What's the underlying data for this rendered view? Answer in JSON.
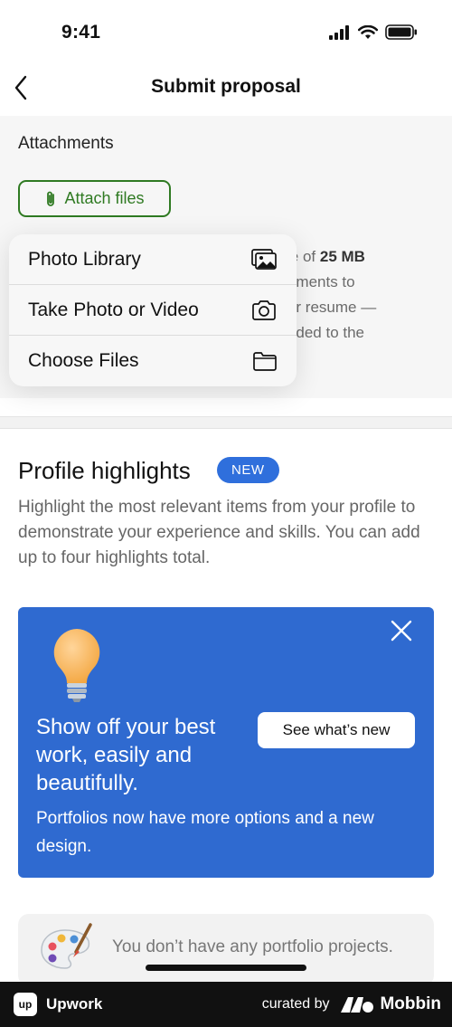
{
  "status_bar": {
    "time": "9:41",
    "icons": [
      "signal-icon",
      "wifi-icon",
      "battery-icon"
    ]
  },
  "nav": {
    "back_icon": "chevron-left-icon",
    "title": "Submit proposal"
  },
  "attachments": {
    "heading": "Attachments",
    "attach_button_label": "Attach files",
    "attach_icon": "paperclip-icon",
    "info_lines": [
      "size of",
      "25 MB",
      "ocuments to",
      "your resume —",
      "warded to the"
    ]
  },
  "popover": {
    "items": [
      {
        "label": "Photo Library",
        "icon": "photo-library-icon"
      },
      {
        "label": "Take Photo or Video",
        "icon": "camera-icon"
      },
      {
        "label": "Choose Files",
        "icon": "folder-icon"
      }
    ]
  },
  "profile_highlights": {
    "title": "Profile highlights",
    "badge": "NEW",
    "description": "Highlight the most relevant items from your profile to demonstrate your experience and skills. You can add up to four highlights total."
  },
  "promo_card": {
    "title": "Show off your best work, easily and beautifully.",
    "cta_label": "See what’s new",
    "subtitle": "Portfolios now have more options and a new design.",
    "close_icon": "close-icon",
    "illustration": "lightbulb-icon",
    "background_color": "#2f6ad0"
  },
  "portfolio": {
    "empty_text": "You don’t have any portfolio projects.",
    "illustration": "palette-icon"
  },
  "footer": {
    "app_name": "Upwork",
    "app_logo_text": "up",
    "curated_by": "curated by",
    "curator": "Mobbin"
  },
  "colors": {
    "accent_green": "#2f7a22",
    "badge_blue": "#2f6fdc"
  }
}
